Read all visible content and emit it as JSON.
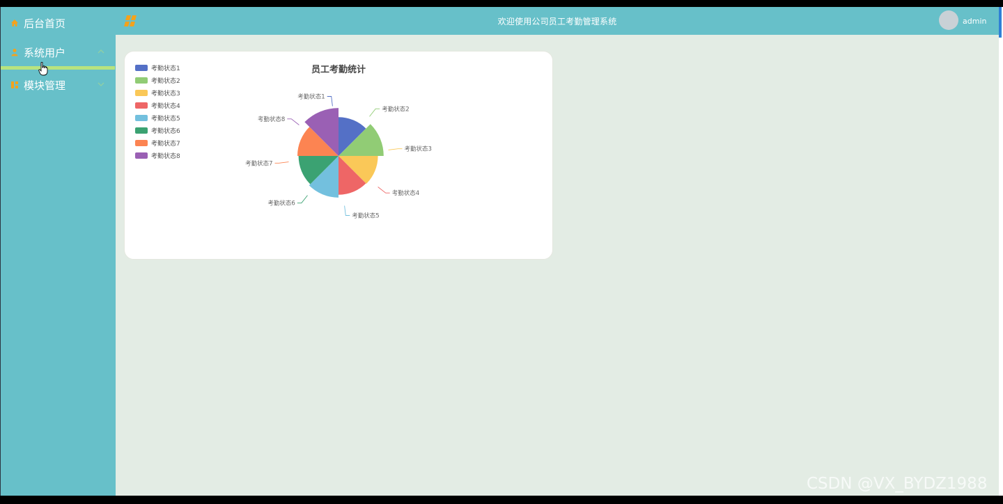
{
  "sidebar": {
    "items": [
      {
        "label": "后台首页",
        "icon": "home-icon"
      },
      {
        "label": "系统用户",
        "icon": "user-icon"
      },
      {
        "label": "模块管理",
        "icon": "module-icon"
      }
    ]
  },
  "header": {
    "title": "欢迎使用公司员工考勤管理系统",
    "username": "admin"
  },
  "colors": {
    "sidebar": "#67c0c9",
    "content_bg": "#e3ece4",
    "accent_underline": "#b7e37f",
    "icon_orange": "#f4a21b"
  },
  "chart_data": {
    "type": "pie",
    "title": "员工考勤统计",
    "legend_position": "top-left",
    "rose": true,
    "series": [
      {
        "name": "考勤状态1",
        "value": 1,
        "radius_value": 68,
        "color": "#5470c6"
      },
      {
        "name": "考勤状态2",
        "value": 1,
        "radius_value": 79,
        "color": "#91cc75"
      },
      {
        "name": "考勤状态3",
        "value": 1,
        "radius_value": 69,
        "color": "#fac858"
      },
      {
        "name": "考勤状态4",
        "value": 1,
        "radius_value": 68,
        "color": "#ee6666"
      },
      {
        "name": "考勤状态5",
        "value": 1,
        "radius_value": 73,
        "color": "#73c0de"
      },
      {
        "name": "考勤状态6",
        "value": 1,
        "radius_value": 70,
        "color": "#3ba272"
      },
      {
        "name": "考勤状态7",
        "value": 1,
        "radius_value": 72,
        "color": "#fc8452"
      },
      {
        "name": "考勤状态8",
        "value": 1,
        "radius_value": 84,
        "color": "#9a60b4"
      }
    ],
    "pie_labels": [
      "考勤状态1",
      "考勤状态2",
      "考勤状态3",
      "考勤状态4",
      "考勤状态5",
      "考勤状态6",
      "考勤状态7",
      "考勤状态8"
    ]
  },
  "watermark": "CSDN @VX_BYDZ1988"
}
